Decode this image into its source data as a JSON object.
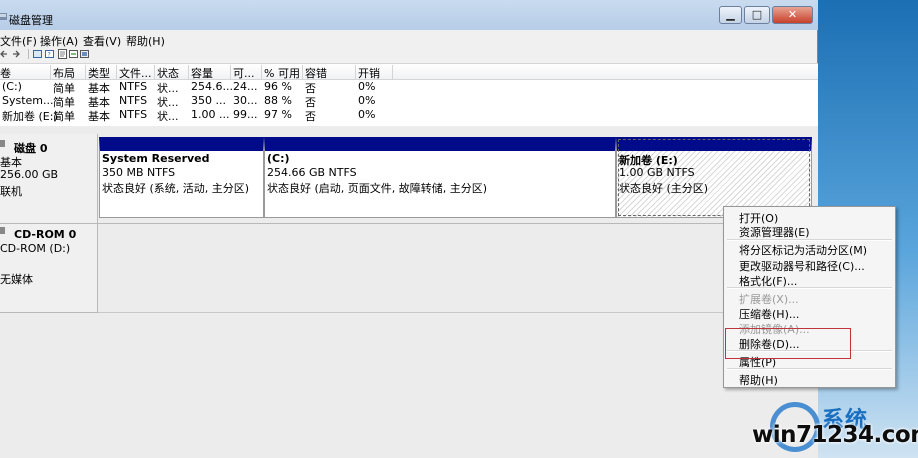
{
  "window": {
    "title": "磁盘管理"
  },
  "menu": [
    "文件(F)",
    "操作(A)",
    "查看(V)",
    "帮助(H)"
  ],
  "table": {
    "headers": [
      "卷",
      "布局",
      "类型",
      "文件...",
      "状态",
      "容量",
      "可...",
      "% 可用",
      "容错",
      "开销"
    ],
    "rows": [
      [
        "(C:)",
        "简单",
        "基本",
        "NTFS",
        "状...",
        "254.6...",
        "24...",
        "96 %",
        "否",
        "0%"
      ],
      [
        "System...",
        "简单",
        "基本",
        "NTFS",
        "状...",
        "350 ...",
        "30...",
        "88 %",
        "否",
        "0%"
      ],
      [
        "新加卷 (E:)",
        "简单",
        "基本",
        "NTFS",
        "状...",
        "1.00 ...",
        "99...",
        "97 %",
        "否",
        "0%"
      ]
    ]
  },
  "disk0": {
    "label": "磁盘 0",
    "type": "基本",
    "size": "256.00 GB",
    "status": "联机",
    "partitions": [
      {
        "name": "System Reserved",
        "size": "350 MB NTFS",
        "status": "状态良好 (系统, 活动, 主分区)"
      },
      {
        "name": "(C:)",
        "size": "254.66 GB NTFS",
        "status": "状态良好 (启动, 页面文件, 故障转储, 主分区)"
      },
      {
        "name": "新加卷  (E:)",
        "size": "1.00 GB NTFS",
        "status": "状态良好 (主分区)"
      }
    ]
  },
  "cdrom0": {
    "label": "CD-ROM 0",
    "drive": "CD-ROM (D:)",
    "media": "无媒体"
  },
  "context_menu": {
    "items": [
      {
        "label": "打开(O)",
        "enabled": true
      },
      {
        "label": "资源管理器(E)",
        "enabled": true
      },
      {
        "label": "将分区标记为活动分区(M)",
        "enabled": true
      },
      {
        "label": "更改驱动器号和路径(C)...",
        "enabled": true
      },
      {
        "label": "格式化(F)...",
        "enabled": true
      },
      {
        "label": "扩展卷(X)...",
        "enabled": false
      },
      {
        "label": "压缩卷(H)...",
        "enabled": true
      },
      {
        "label": "添加镜像(A)...",
        "enabled": false
      },
      {
        "label": "删除卷(D)...",
        "enabled": true
      },
      {
        "label": "属性(P)",
        "enabled": true
      },
      {
        "label": "帮助(H)",
        "enabled": true
      }
    ]
  },
  "watermark": {
    "text": "win71234.com",
    "brand": "系统"
  },
  "colors": {
    "partition_header": "#000b8c",
    "highlight_box": "#c0333b"
  }
}
